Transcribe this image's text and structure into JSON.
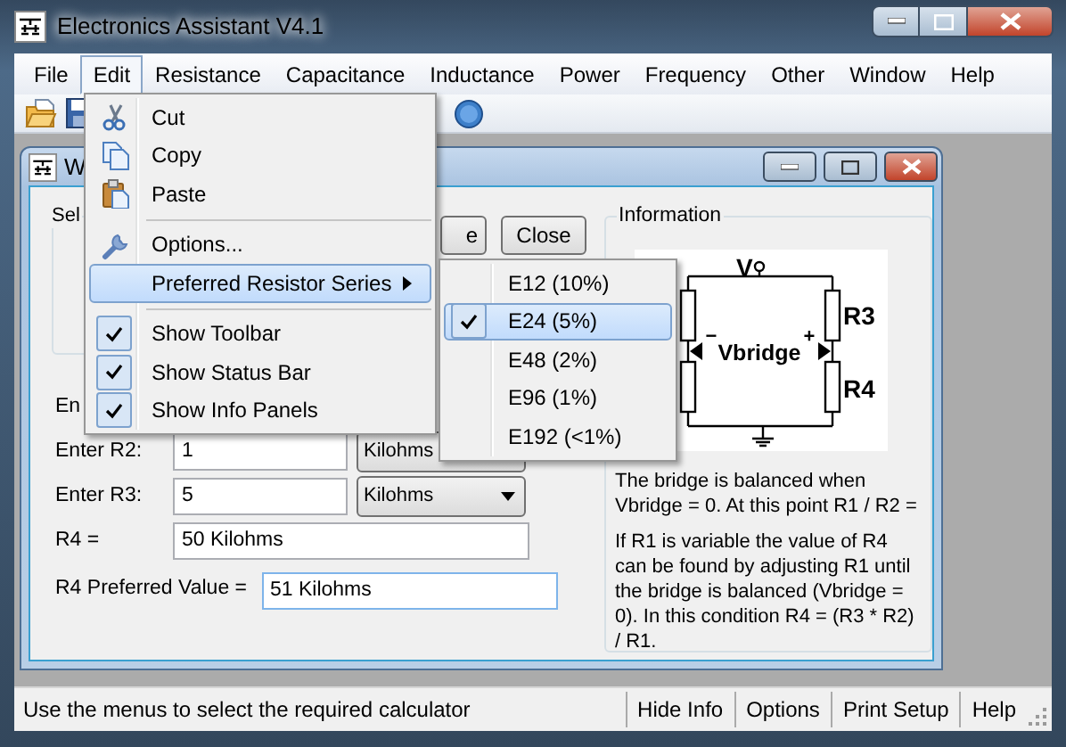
{
  "window": {
    "title": "Electronics Assistant V4.1"
  },
  "menu_bar": [
    {
      "label": "File",
      "selected": false
    },
    {
      "label": "Edit",
      "selected": true
    },
    {
      "label": "Resistance",
      "selected": false
    },
    {
      "label": "Capacitance",
      "selected": false
    },
    {
      "label": "Inductance",
      "selected": false
    },
    {
      "label": "Power",
      "selected": false
    },
    {
      "label": "Frequency",
      "selected": false
    },
    {
      "label": "Other",
      "selected": false
    },
    {
      "label": "Window",
      "selected": false
    },
    {
      "label": "Help",
      "selected": false
    }
  ],
  "child_window": {
    "title": "W",
    "selection_group": {
      "title": "Sel"
    },
    "buttons": [
      "e",
      "Close"
    ],
    "fields": [
      {
        "kind": "hidden",
        "label": "En"
      },
      {
        "kind": "input",
        "label": "Enter R2:",
        "value": "1",
        "unit": "Kilohms"
      },
      {
        "kind": "input",
        "label": "Enter R3:",
        "value": "5",
        "unit": "Kilohms"
      },
      {
        "kind": "result",
        "label": "R4 =",
        "value": "50 Kilohms"
      },
      {
        "kind": "result",
        "label": "R4 Preferred Value =",
        "value": "51 Kilohms"
      }
    ],
    "information": {
      "title": "Information",
      "diagram_labels": {
        "supply": "V",
        "bridge": "Vbridge",
        "minus": "−",
        "plus": "+",
        "upper": "R3",
        "lower": "R4"
      },
      "paragraphs": [
        "The bridge is balanced when Vbridge = 0. At this point R1 / R2 =",
        "If R1 is variable the value of R4 can be found by adjusting R1 until the bridge is balanced (Vbridge = 0). In this condition R4 = (R3 * R2) / R1."
      ]
    }
  },
  "edit_menu": [
    {
      "kind": "command",
      "label": "Cut"
    },
    {
      "kind": "command",
      "label": "Copy"
    },
    {
      "kind": "command",
      "label": "Paste"
    },
    {
      "kind": "separator"
    },
    {
      "kind": "command",
      "label": "Options..."
    },
    {
      "kind": "submenu",
      "label": "Preferred Resistor Series",
      "selected": true
    },
    {
      "kind": "separator"
    },
    {
      "kind": "toggle",
      "label": "Show Toolbar",
      "checked": true
    },
    {
      "kind": "toggle",
      "label": "Show Status Bar",
      "checked": true
    },
    {
      "kind": "toggle",
      "label": "Show Info Panels",
      "checked": true
    }
  ],
  "series_submenu": [
    {
      "label": "E12 (10%)",
      "checked": false,
      "selected": false
    },
    {
      "label": "E24 (5%)",
      "checked": true,
      "selected": true
    },
    {
      "label": "E48 (2%)",
      "checked": false,
      "selected": false
    },
    {
      "label": "E96 (1%)",
      "checked": false,
      "selected": false
    },
    {
      "label": "E192 (<1%)",
      "checked": false,
      "selected": false
    }
  ],
  "status_bar": {
    "message": "Use the menus to select the required calculator",
    "panels": [
      "Hide Info",
      "Options",
      "Print Setup",
      "Help"
    ]
  }
}
